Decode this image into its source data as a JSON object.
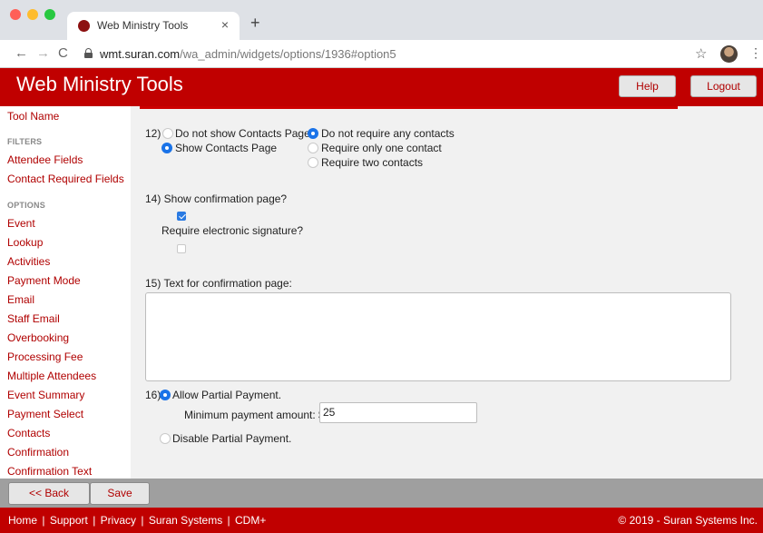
{
  "browser": {
    "tab_title": "Web Ministry Tools",
    "tab_close": "×",
    "new_tab": "+",
    "url_host": "wmt.suran.com",
    "url_path": "/wa_admin/widgets/options/1936#option5",
    "back_glyph": "←",
    "forward_glyph": "→",
    "reload_glyph": "C",
    "star_glyph": "☆",
    "menu_glyph": "⋮"
  },
  "header": {
    "title": "Web Ministry Tools",
    "help_label": "Help",
    "logout_label": "Logout",
    "brand_color": "#c00000"
  },
  "sidebar": {
    "top_item": "Tool Name",
    "filters_heading": "FILTERS",
    "filters": [
      "Attendee Fields",
      "Contact Required Fields"
    ],
    "options_heading": "OPTIONS",
    "options": [
      "Event",
      "Lookup",
      "Activities",
      "Payment Mode",
      "Email",
      "Staff Email",
      "Overbooking",
      "Processing Fee",
      "Multiple Attendees",
      "Event Summary",
      "Payment Select",
      "Contacts",
      "Confirmation",
      "Confirmation Text"
    ]
  },
  "form": {
    "q12": {
      "number": "12)",
      "opt_hide": "Do not show Contacts Page",
      "opt_show": "Show Contacts Page",
      "opt_none": "Do not require any contacts",
      "opt_one": "Require only one contact",
      "opt_two": "Require two contacts",
      "selected_page": "Show Contacts Page",
      "selected_requirement": "Do not require any contacts"
    },
    "q14": {
      "label": "14) Show confirmation page?",
      "show_checked": true,
      "signature_label": "Require electronic signature?",
      "signature_checked": false
    },
    "q15": {
      "label": "15) Text for confirmation page:",
      "value": ""
    },
    "q16": {
      "number": "16)",
      "allow_label": "Allow Partial Payment.",
      "min_label": "Minimum payment amount: $",
      "min_value": "25",
      "disable_label": "Disable Partial Payment.",
      "selected": "Allow Partial Payment."
    }
  },
  "buttons": {
    "back_label": "<< Back",
    "save_label": "Save"
  },
  "footer": {
    "links": [
      "Home",
      "Support",
      "Privacy",
      "Suran Systems",
      "CDM+"
    ],
    "separator": "|",
    "copyright": "© 2019 - Suran Systems Inc."
  }
}
